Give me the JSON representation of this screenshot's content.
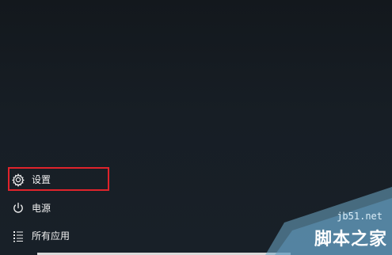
{
  "start_menu": {
    "items": [
      {
        "label": "设置",
        "icon": "gear-icon"
      },
      {
        "label": "电源",
        "icon": "power-icon"
      },
      {
        "label": "所有应用",
        "icon": "all-apps-list-icon"
      }
    ]
  },
  "watermark": {
    "domain": "jb51.net",
    "name": "脚本之家"
  },
  "colors": {
    "highlight": "#e0232b",
    "background": "#161c22",
    "text": "#f2f2f2"
  }
}
